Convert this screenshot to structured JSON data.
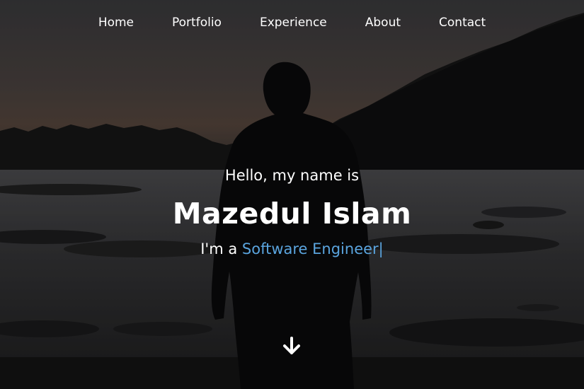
{
  "nav": {
    "items": [
      {
        "label": "Home"
      },
      {
        "label": "Portfolio"
      },
      {
        "label": "Experience"
      },
      {
        "label": "About"
      },
      {
        "label": "Contact"
      }
    ]
  },
  "hero": {
    "greeting": "Hello, my name is",
    "name": "Mazedul Islam",
    "role_prefix": "I'm a ",
    "role_highlight": "Software Engineer",
    "cursor": "|",
    "scroll_icon": "arrow-down-icon"
  },
  "colors": {
    "accent": "#5aa4de",
    "text": "#ffffff"
  }
}
